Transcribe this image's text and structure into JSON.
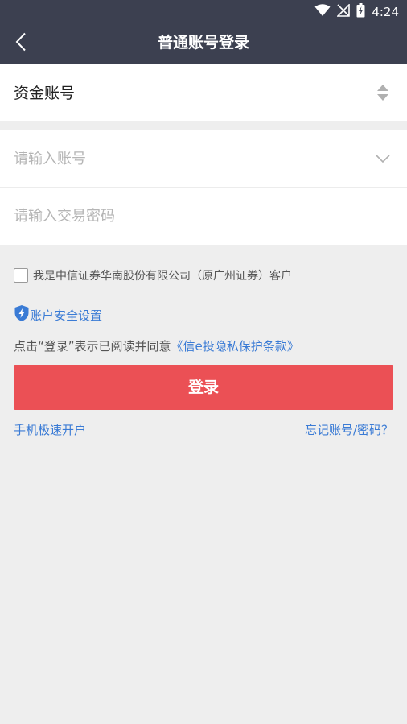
{
  "status_bar": {
    "time": "4:24"
  },
  "header": {
    "title": "普通账号登录"
  },
  "account_type": {
    "label": "资金账号"
  },
  "form": {
    "account_placeholder": "请输入账号",
    "password_placeholder": "请输入交易密码"
  },
  "agreement": {
    "checkbox_text": "我是中信证券华南股份有限公司（原广州证券）客户",
    "checked": false
  },
  "security": {
    "link_text": "账户安全设置"
  },
  "privacy": {
    "prefix": "点击“登录”表示已阅读并同意",
    "link_text": "《信e投隐私保护条款》"
  },
  "login_button": {
    "label": "登录"
  },
  "links": {
    "open_account": "手机极速开户",
    "forgot": "忘记账号/密码？"
  },
  "colors": {
    "header_bg": "#3c4050",
    "accent_red": "#eb5055",
    "link_blue": "#3a7bd5",
    "page_bg": "#eeeeee"
  },
  "icons": {
    "wifi": "wifi-icon",
    "signal": "no-signal-icon",
    "battery": "battery-charging-icon",
    "back": "back-arrow-icon",
    "sort": "sort-updown-icon",
    "dropdown": "chevron-down-icon",
    "shield": "shield-lightning-icon"
  }
}
